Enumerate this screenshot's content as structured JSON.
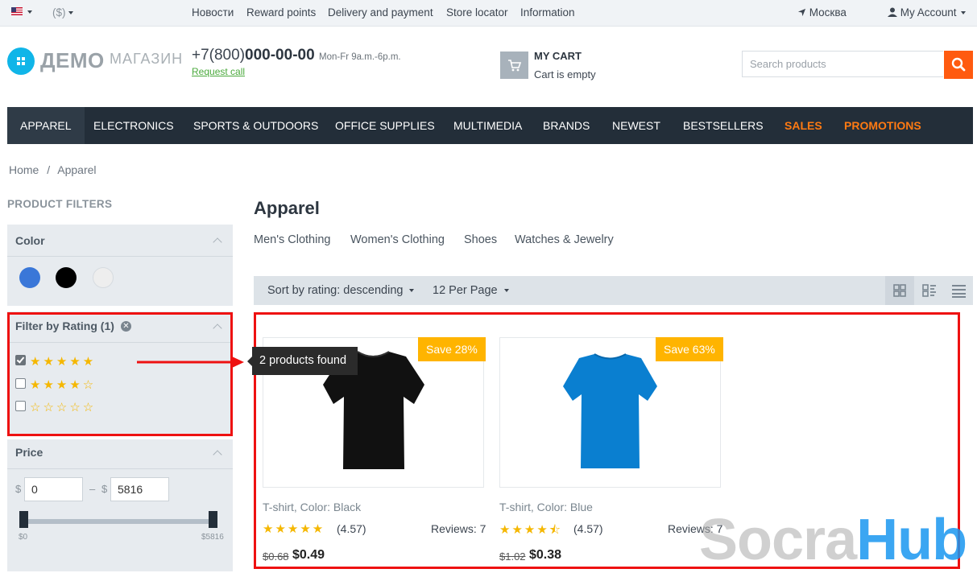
{
  "topbar": {
    "currency": "($)",
    "links": [
      "Новости",
      "Reward points",
      "Delivery and payment",
      "Store locator",
      "Information"
    ],
    "location": "Москва",
    "account": "My Account"
  },
  "header": {
    "logo_main": "ДЕМО",
    "logo_sub": "МАГАЗИН",
    "phone_prefix": "+7(800)",
    "phone_main": "000-00-00",
    "hours": "Mon-Fr 9a.m.-6p.m.",
    "request_call": "Request call",
    "cart_title": "MY CART",
    "cart_status": "Cart is empty",
    "search_placeholder": "Search products"
  },
  "nav": {
    "items": [
      "Apparel",
      "Electronics",
      "Sports & Outdoors",
      "Office Supplies",
      "Multimedia",
      "Brands",
      "Newest",
      "Bestsellers",
      "Sales",
      "Promotions"
    ],
    "active_index": 0,
    "highlight_color": "#ff7a12"
  },
  "breadcrumb": {
    "home": "Home",
    "sep": "/",
    "current": "Apparel"
  },
  "filters": {
    "title": "PRODUCT FILTERS",
    "color": {
      "title": "Color",
      "swatches": [
        "#3a77d8",
        "#000000",
        "#eeeeee"
      ]
    },
    "rating": {
      "title": "Filter by Rating (1)",
      "options": [
        {
          "stars": "★★★★★",
          "checked": true
        },
        {
          "stars": "★★★★☆",
          "checked": false
        },
        {
          "stars": "☆☆☆☆☆",
          "checked": false
        }
      ]
    },
    "price": {
      "title": "Price",
      "currency": "$",
      "dash": "–",
      "min": "0",
      "max": "5816",
      "min_label": "$0",
      "max_label": "$5816"
    }
  },
  "main": {
    "title": "Apparel",
    "subcategories": [
      "Men's Clothing",
      "Women's Clothing",
      "Shoes",
      "Watches & Jewelry"
    ],
    "sort": "Sort by rating: descending",
    "per_page": "12 Per Page"
  },
  "tooltip": "2 products found",
  "products": [
    {
      "name": "T-shirt, Color: Black",
      "save": "Save 28%",
      "stars": "★★★★★",
      "rating": "(4.57)",
      "reviews": "Reviews: 7",
      "old_price": "$0.68",
      "price": "$0.49",
      "color": "#111111"
    },
    {
      "name": "T-shirt, Color: Blue",
      "save": "Save 63%",
      "stars": "★★★★⯪",
      "rating": "(4.57)",
      "reviews": "Reviews: 7",
      "old_price": "$1.02",
      "price": "$0.38",
      "color": "#0a7fd0"
    }
  ],
  "watermark": {
    "part1": "Socra",
    "part2": "Hub"
  },
  "colors": {
    "accent": "#ff5a0f",
    "nav_bg": "#232e39",
    "highlight": "#ee1111",
    "star": "#f5b700",
    "badge": "#ffb400"
  }
}
